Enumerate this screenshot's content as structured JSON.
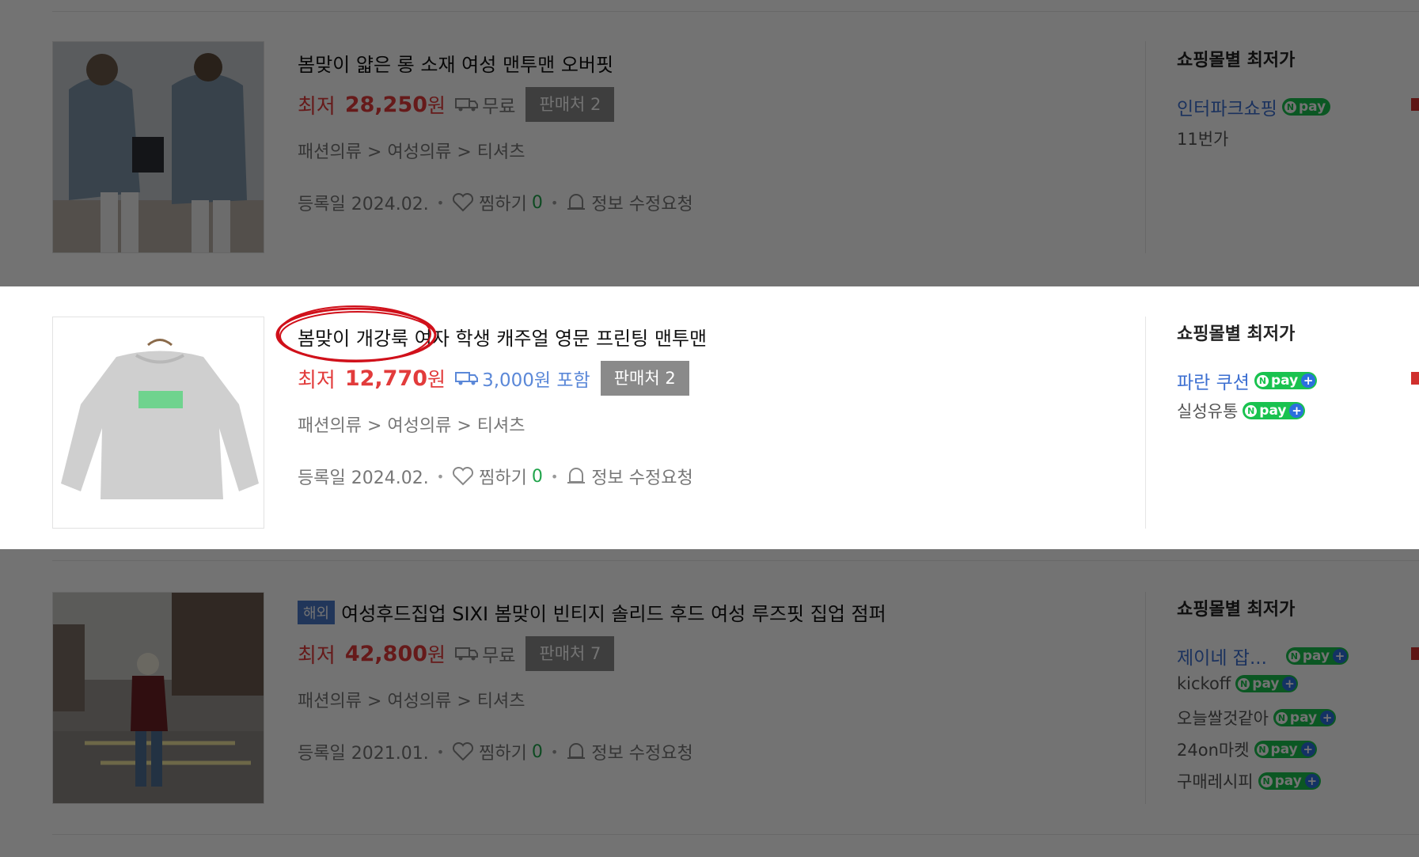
{
  "section_title": "쇼핑몰별 최저가",
  "products": [
    {
      "title": "봄맞이 얇은 롱 소재 여성 맨투맨 오버핏",
      "overseas_badge": "",
      "price_label": "최저",
      "price": "28,250",
      "currency": "원",
      "shipping": "무료",
      "sellers": "판매처 2",
      "category": "패션의류 > 여성의류 > 티셔츠",
      "registered": "등록일 2024.02.",
      "wish_label": "찜하기",
      "wish_count": "0",
      "report": "정보 수정요청",
      "malls": [
        {
          "name": "인터파크쇼핑",
          "npay": "pay",
          "plus": false,
          "link": true
        },
        {
          "name": "11번가",
          "npay": "",
          "plus": false,
          "link": false
        }
      ]
    },
    {
      "title": "봄맞이 개강룩 여자 학생 캐주얼 영문 프린팅 맨투맨",
      "overseas_badge": "",
      "price_label": "최저",
      "price": "12,770",
      "currency": "원",
      "shipping": "3,000원 포함",
      "sellers": "판매처 2",
      "category": "패션의류 > 여성의류 > 티셔츠",
      "registered": "등록일 2024.02.",
      "wish_label": "찜하기",
      "wish_count": "0",
      "report": "정보 수정요청",
      "malls": [
        {
          "name": "파란 쿠션",
          "npay": "pay",
          "plus": true,
          "link": true
        },
        {
          "name": "실성유통",
          "npay": "pay",
          "plus": true,
          "link": false
        }
      ]
    },
    {
      "title": "여성후드집업 SIXI 봄맞이 빈티지 솔리드 후드 여성 루즈핏 집업 점퍼",
      "overseas_badge": "해외",
      "price_label": "최저",
      "price": "42,800",
      "currency": "원",
      "shipping": "무료",
      "sellers": "판매처 7",
      "category": "패션의류 > 여성의류 > 티셔츠",
      "registered": "등록일 2021.01.",
      "wish_label": "찜하기",
      "wish_count": "0",
      "report": "정보 수정요청",
      "malls": [
        {
          "name": "제이네 잡...",
          "npay": "pay",
          "plus": true,
          "link": true
        },
        {
          "name": "kickoff",
          "npay": "pay",
          "plus": true,
          "link": false
        },
        {
          "name": "오늘쌀것같아",
          "npay": "pay",
          "plus": true,
          "link": false
        },
        {
          "name": "24on마켓",
          "npay": "pay",
          "plus": true,
          "link": false
        },
        {
          "name": "구매레시피",
          "npay": "pay",
          "plus": true,
          "link": false
        }
      ]
    }
  ],
  "colors": {
    "price": "#e23b3b",
    "npay": "#19c24f",
    "link": "#3c6fd1",
    "overlay": "rgba(0,0,0,0.55)",
    "highlight": "#d0101a"
  }
}
